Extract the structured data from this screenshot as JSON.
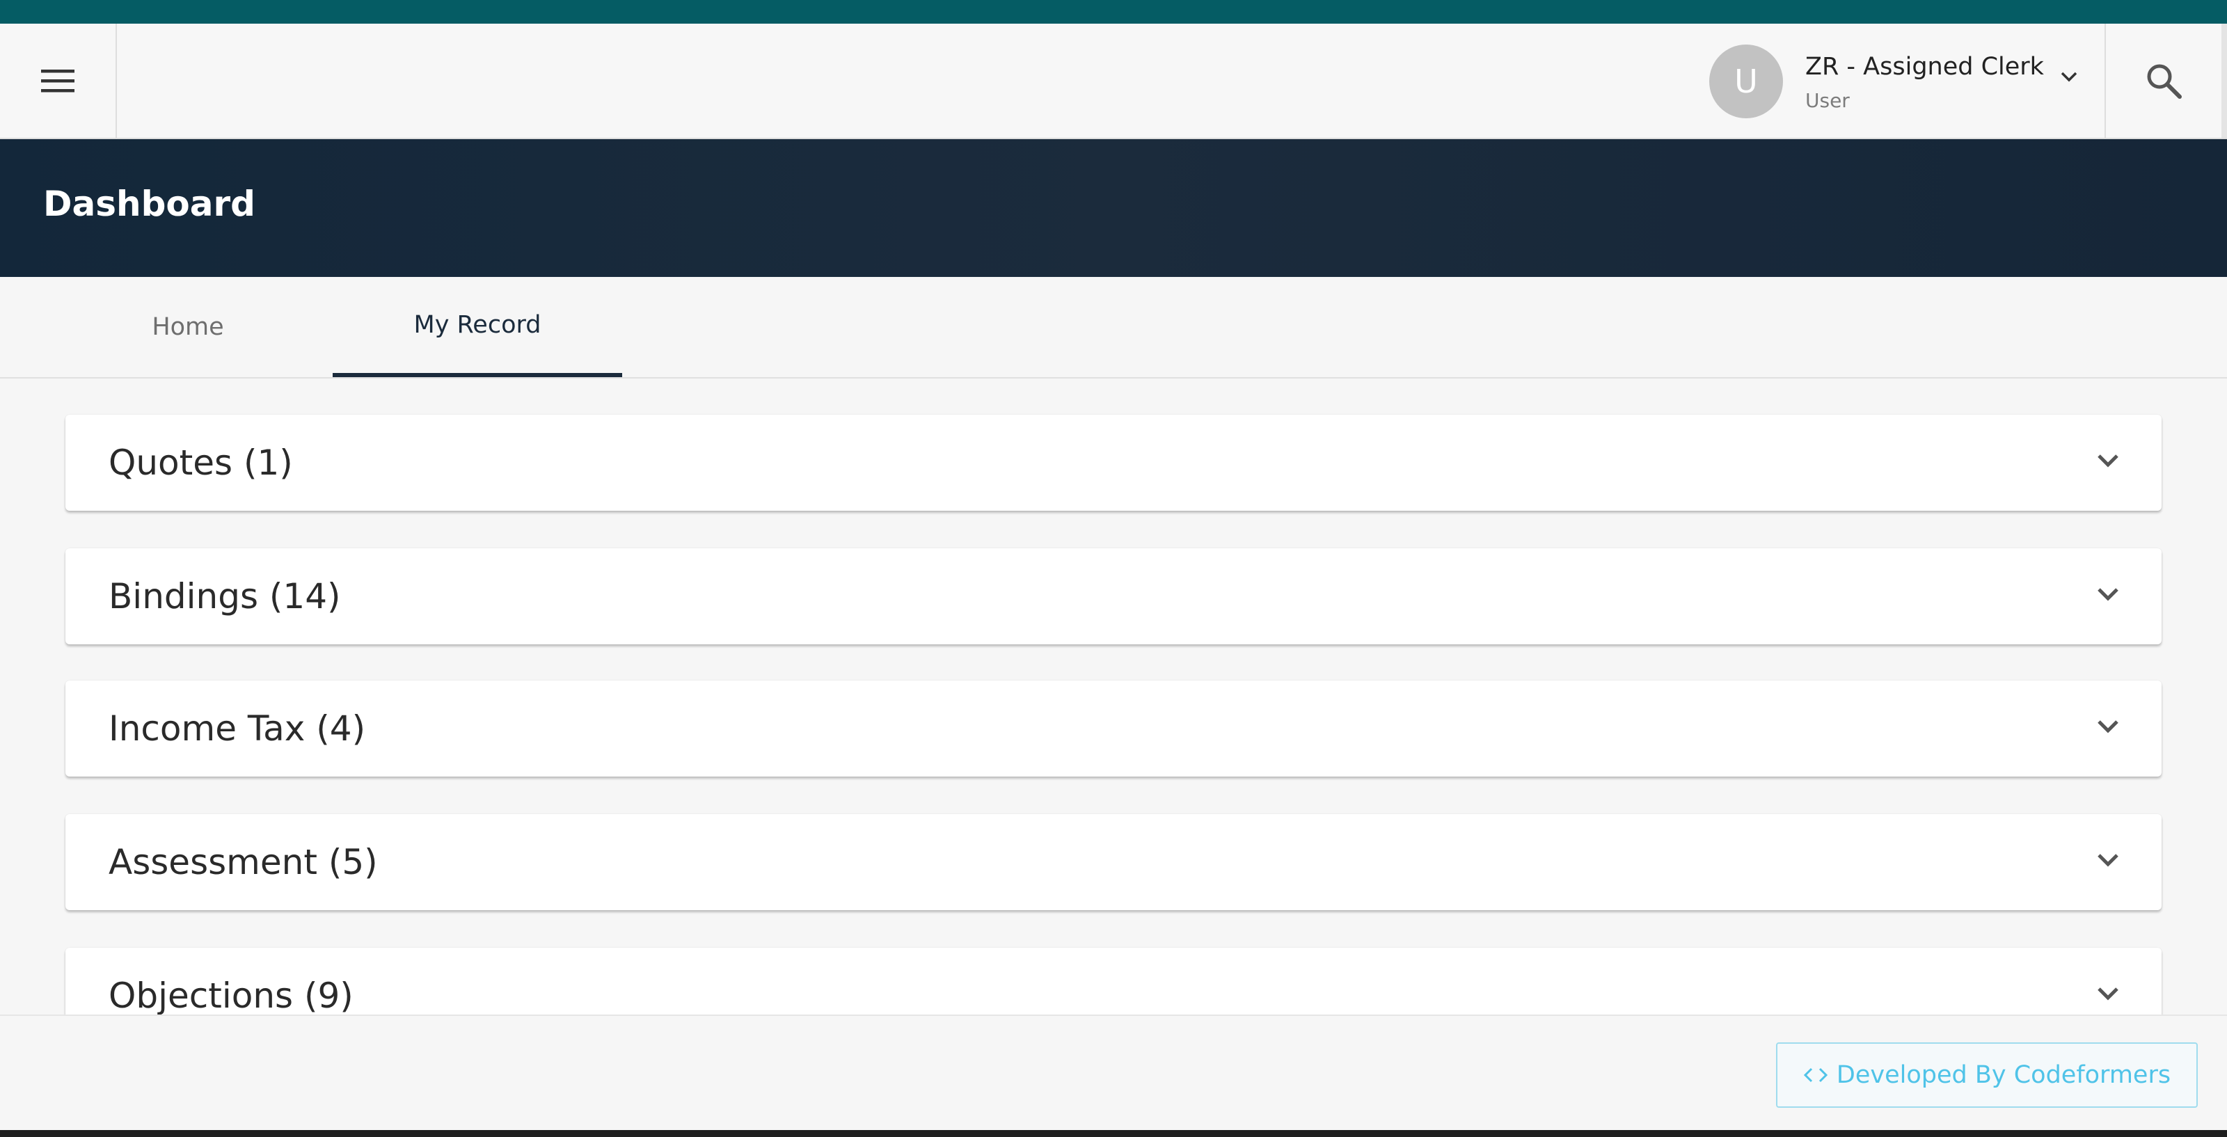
{
  "navbar": {
    "user": {
      "avatar_letter": "U",
      "name": "ZR - Assigned Clerk",
      "role": "User"
    }
  },
  "header": {
    "title": "Dashboard"
  },
  "tabs": [
    {
      "label": "Home",
      "active": false
    },
    {
      "label": "My Record",
      "active": true
    }
  ],
  "panels": [
    {
      "title": "Quotes (1)"
    },
    {
      "title": "Bindings (14)"
    },
    {
      "title": "Income Tax (4)"
    },
    {
      "title": "Assessment (5)"
    },
    {
      "title": "Objections (9)"
    }
  ],
  "footer": {
    "developer_label": "Developed By Codeformers"
  },
  "colors": {
    "top_strip": "#055c64",
    "header_band": "#1b2b3c",
    "accent": "#4fc3e8"
  },
  "icons": [
    "menu-icon",
    "chevron-down-icon",
    "search-icon",
    "code-icon"
  ]
}
